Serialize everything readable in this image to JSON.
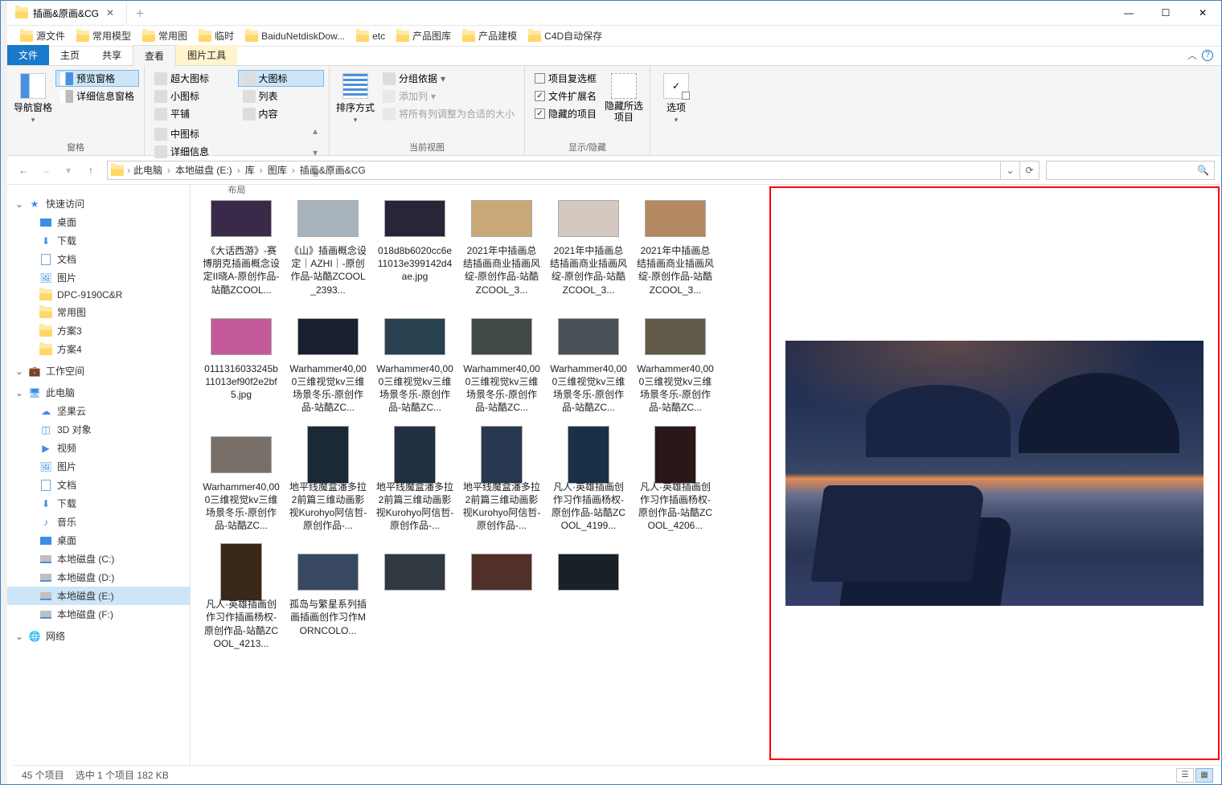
{
  "window": {
    "tab_title": "插画&原画&CG"
  },
  "bookmarks": [
    "源文件",
    "常用模型",
    "常用图",
    "临时",
    "BaiduNetdiskDow...",
    "etc",
    "产品图库",
    "产品建模",
    "C4D自动保存"
  ],
  "menu_tabs": {
    "file": "文件",
    "home": "主页",
    "share": "共享",
    "view": "查看",
    "context": "图片工具"
  },
  "ribbon": {
    "panes": {
      "label": "窗格",
      "navpane": "导航窗格",
      "preview": "预览窗格",
      "details": "详细信息窗格"
    },
    "layout": {
      "label": "布局",
      "xl": "超大图标",
      "l": "大图标",
      "m": "中图标",
      "s": "小图标",
      "list": "列表",
      "details": "详细信息",
      "tiles": "平铺",
      "content": "内容"
    },
    "currentview": {
      "label": "当前视图",
      "sort": "排序方式",
      "group": "分组依据",
      "addcol": "添加列",
      "fit": "将所有列调整为合适的大小"
    },
    "showhide": {
      "label": "显示/隐藏",
      "chk_multisel": "项目复选框",
      "chk_ext": "文件扩展名",
      "chk_hidden": "隐藏的项目",
      "hide_btn": "隐藏所选项目"
    },
    "options": {
      "label": "",
      "btn": "选项"
    }
  },
  "breadcrumb": [
    "此电脑",
    "本地磁盘 (E:)",
    "库",
    "图库",
    "插画&原画&CG"
  ],
  "nav": {
    "quick": {
      "label": "快速访问",
      "items": [
        "桌面",
        "下载",
        "文档",
        "图片",
        "DPC-9190C&R",
        "常用图",
        "方案3",
        "方案4"
      ]
    },
    "workspace": "工作空间",
    "thispc": {
      "label": "此电脑",
      "items": [
        "坚果云",
        "3D 对象",
        "视频",
        "图片",
        "文档",
        "下载",
        "音乐",
        "桌面",
        "本地磁盘 (C:)",
        "本地磁盘 (D:)",
        "本地磁盘 (E:)",
        "本地磁盘 (F:)"
      ]
    },
    "network": "网络"
  },
  "files": [
    {
      "name": "《大话西游》-赛博朋克插画概念设定II晓A-原创作品-站酷ZCOOL...",
      "c": "#3a2a4a"
    },
    {
      "name": "《山》插画概念设定｜AZHI｜-原创作品-站酷ZCOOL_2393...",
      "c": "#a8b4bd"
    },
    {
      "name": "018d8b6020cc6e11013e399142d4ae.jpg",
      "c": "#2a2438"
    },
    {
      "name": "2021年中插画总结插画商业插画风绽-原创作品-站酷ZCOOL_3...",
      "c": "#c9a878"
    },
    {
      "name": "2021年中插画总结插画商业插画风绽-原创作品-站酷ZCOOL_3...",
      "c": "#d4c8c0"
    },
    {
      "name": "2021年中插画总结插画商业插画风绽-原创作品-站酷ZCOOL_3...",
      "c": "#b48860"
    },
    {
      "name": "0111316033245b11013ef90f2e2bf5.jpg",
      "c": "#c45a9a"
    },
    {
      "name": "Warhammer40,000三维视觉kv三维场景冬乐-原创作品-站酷ZC...",
      "c": "#1a2030"
    },
    {
      "name": "Warhammer40,000三维视觉kv三维场景冬乐-原创作品-站酷ZC...",
      "c": "#284050"
    },
    {
      "name": "Warhammer40,000三维视觉kv三维场景冬乐-原创作品-站酷ZC...",
      "c": "#404848"
    },
    {
      "name": "Warhammer40,000三维视觉kv三维场景冬乐-原创作品-站酷ZC...",
      "c": "#485058"
    },
    {
      "name": "Warhammer40,000三维视觉kv三维场景冬乐-原创作品-站酷ZC...",
      "c": "#605848"
    },
    {
      "name": "Warhammer40,000三维视觉kv三维场景冬乐-原创作品-站酷ZC...",
      "c": "#787068"
    },
    {
      "name": "地平线魔盒潘多拉2前篇三维动画影视Kurohyo阿信哲-原创作品-...",
      "c": "#1a2838",
      "tall": true
    },
    {
      "name": "地平线魔盒潘多拉2前篇三维动画影视Kurohyo阿信哲-原创作品-...",
      "c": "#203040",
      "tall": true
    },
    {
      "name": "地平线魔盒潘多拉2前篇三维动画影视Kurohyo阿信哲-原创作品-...",
      "c": "#283850",
      "tall": true
    },
    {
      "name": "凡人·英雄插画创作习作插画杨权-原创作品-站酷ZCOOL_4199...",
      "c": "#1a3048",
      "tall": true
    },
    {
      "name": "凡人·英雄插画创作习作插画杨权-原创作品-站酷ZCOOL_4206...",
      "c": "#2a1818",
      "tall": true
    },
    {
      "name": "凡人·英雄插画创作习作插画杨权-原创作品-站酷ZCOOL_4213...",
      "c": "#3a2818",
      "tall": true
    },
    {
      "name": "孤岛与繁星系列插画插画创作习作MORNCOLO...",
      "c": "#384860"
    },
    {
      "name": "",
      "c": "#303840"
    },
    {
      "name": "",
      "c": "#503028"
    },
    {
      "name": "",
      "c": "#182028"
    }
  ],
  "status": {
    "count": "45 个项目",
    "selection": "选中 1 个项目  182 KB"
  }
}
